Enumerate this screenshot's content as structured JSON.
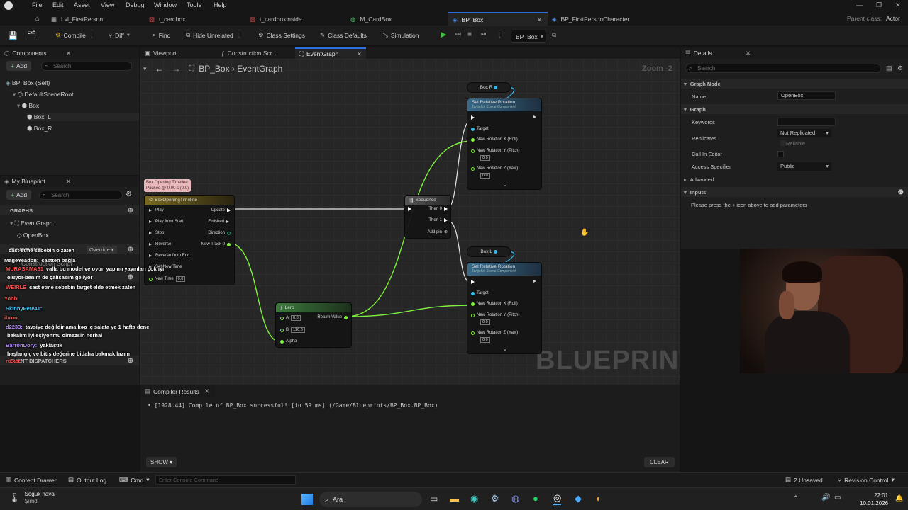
{
  "menu": [
    "File",
    "Edit",
    "Asset",
    "View",
    "Debug",
    "Window",
    "Tools",
    "Help"
  ],
  "doc_tabs": [
    {
      "label": "Lvl_FirstPerson",
      "active": false
    },
    {
      "label": "t_cardbox",
      "active": false
    },
    {
      "label": "t_cardboxinside",
      "active": false
    },
    {
      "label": "M_CardBox",
      "active": false
    },
    {
      "label": "BP_Box",
      "active": true
    },
    {
      "label": "BP_FirstPersonCharacter",
      "active": false
    }
  ],
  "parent_class": {
    "label": "Parent class:",
    "value": "Actor"
  },
  "toolbar": {
    "compile": "Compile",
    "diff": "Diff",
    "find": "Find",
    "hide_unrelated": "Hide Unrelated",
    "class_settings": "Class Settings",
    "class_defaults": "Class Defaults",
    "simulation": "Simulation",
    "debug_object": "BP_Box"
  },
  "components": {
    "title": "Components",
    "add": "Add",
    "search_placeholder": "Search",
    "tree": [
      "BP_Box (Self)",
      "DefaultSceneRoot",
      "Box",
      "Box_L",
      "Box_R"
    ]
  },
  "my_blueprint": {
    "title": "My Blueprint",
    "add": "Add",
    "search_placeholder": "Search",
    "graphs_label": "GRAPHS",
    "graph_items": [
      "EventGraph",
      "OpenBox"
    ],
    "functions_label": "FUNCTIONS",
    "override_label": "Override",
    "macros_label": "MACROS",
    "event_dispatchers_label": "EVENT DISPATCHERS",
    "construction_script": "Construction Script"
  },
  "editor_tabs": [
    "Viewport",
    "Construction Scr...",
    "EventGraph"
  ],
  "breadcrumb": {
    "root": "BP_Box",
    "current": "EventGraph"
  },
  "zoom": "Zoom -2",
  "watermark": "BLUEPRINT",
  "graph_nodes": {
    "timeline_comment": [
      "Box Opening Timeline",
      "Paused @ 0.00 s (0.0)"
    ],
    "timeline": {
      "title": "BoxOpeningTimeline",
      "inputs": [
        "Play",
        "Play from Start",
        "Stop",
        "Reverse",
        "Reverse from End",
        "Set New Time",
        "New Time"
      ],
      "new_time": "0.0",
      "outputs": [
        "Update",
        "Finished",
        "Direction",
        "New Track 0"
      ]
    },
    "sequence": {
      "title": "Sequence",
      "outputs": [
        "Then 0",
        "Then 1"
      ],
      "add_pin": "Add pin"
    },
    "box_r": "Box R",
    "box_l": "Box L",
    "set_rotation_title": "Set Relative Rotation",
    "set_rotation_subtitle": "Target is Scene Component",
    "set_rotation_pins": [
      "Target",
      "New Rotation X (Roll)",
      "New Rotation Y (Pitch)",
      "New Rotation Z (Yaw)"
    ],
    "set_rotation_values": [
      "0.0",
      "0.0"
    ],
    "lerp": {
      "title": "Lerp",
      "a_label": "A",
      "a": "0.0",
      "b_label": "B",
      "b": "120.0",
      "alpha": "Alpha",
      "return": "Return Value"
    }
  },
  "compiler": {
    "title": "Compiler Results",
    "message": "[1928.44] Compile of BP_Box successful! [in 59 ms] (/Game/Blueprints/BP_Box.BP_Box)",
    "show": "SHOW",
    "clear": "CLEAR"
  },
  "details": {
    "title": "Details",
    "search_placeholder": "Search",
    "graph_node_label": "Graph Node",
    "name_label": "Name",
    "name_value": "OpenBox",
    "graph_label": "Graph",
    "keywords_label": "Keywords",
    "replicates_label": "Replicates",
    "replicates_value": "Not Replicated",
    "reliable_label": "Reliable",
    "call_in_editor_label": "Call In Editor",
    "access_label": "Access Specifier",
    "access_value": "Public",
    "advanced_label": "Advanced",
    "inputs_label": "Inputs",
    "inputs_hint": "Please press the + icon above to add parameters"
  },
  "chat": [
    {
      "user": "",
      "text": "cast etme sebebin o zaten",
      "color": "#ff5050"
    },
    {
      "user": "MageYeadon:",
      "text": "castten bağla",
      "color": "#ffffff"
    },
    {
      "user": "MURASAMA61",
      "text": "valla bu model ve oyun yapımı yayınları çok iyi",
      "color": "#ff5050"
    },
    {
      "user": "",
      "text": "oluyor benim de çalışasım geliyor",
      "color": "#ffffff"
    },
    {
      "user": "WEIRLE",
      "text": "cast etme sebebin target elde etmek zaten",
      "color": "#ff5050"
    },
    {
      "user": "Yobbi",
      "text": "",
      "color": "#ff5050"
    },
    {
      "user": "SkinnyPete41:",
      "text": "",
      "color": "#4dd0ff"
    },
    {
      "user": "ibroo:",
      "text": "",
      "color": "#ff5050"
    },
    {
      "user": "d2233:",
      "text": "tavsiye değildir ama ke̶p iç salata ye 1 hafta dene",
      "color": "#b48cff"
    },
    {
      "user": "",
      "text": "bakalım iyileşiyonmu ölmezsin herhal",
      "color": "#ffffff"
    },
    {
      "user": "BarronDory:",
      "text": "yaklaştık",
      "color": "#b48cff"
    },
    {
      "user": "",
      "text": "başlangıç ve bitiş değerine bidaha bakmak lazım",
      "color": "#ffffff"
    },
    {
      "user": "rixxer",
      "text": "",
      "color": "#ff5050"
    }
  ],
  "statusbar": {
    "content_drawer": "Content Drawer",
    "output_log": "Output Log",
    "cmd": "Cmd",
    "console_placeholder": "Enter Console Command",
    "unsaved": "2 Unsaved",
    "revision": "Revision Control"
  },
  "taskbar": {
    "weather_title": "Soğuk hava",
    "weather_sub": "Şimdi",
    "search": "Ara",
    "time": "22:01",
    "date": "10.01.2026"
  }
}
